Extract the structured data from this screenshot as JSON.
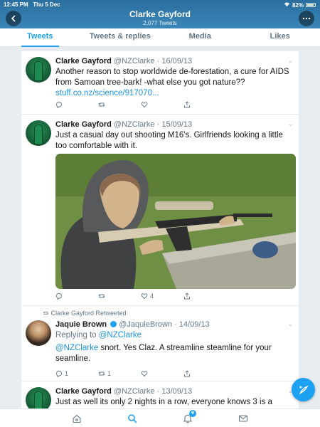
{
  "status": {
    "time": "12:45 PM",
    "day": "Thu 5 Dec",
    "battery": "82%"
  },
  "header": {
    "title": "Clarke Gayford",
    "subtitle": "2,077 Tweets"
  },
  "tabs": [
    {
      "label": "Tweets",
      "active": true
    },
    {
      "label": "Tweets & replies",
      "active": false
    },
    {
      "label": "Media",
      "active": false
    },
    {
      "label": "Likes",
      "active": false
    }
  ],
  "tweets": [
    {
      "name": "Clarke Gayford",
      "handle": "@NZClarke · 16/09/13",
      "text": "Another reason to stop worldwide de-forestation, a cure for AIDS from Samoan tree-bark! -what else you got nature??",
      "link": "stuff.co.nz/science/917070...",
      "actions": {
        "reply": "",
        "retweet": "",
        "like": "",
        "share": ""
      }
    },
    {
      "name": "Clarke Gayford",
      "handle": "@NZClarke · 15/09/13",
      "text": "Just a casual day out shooting M16's. Girlfriends looking a little too comfortable with it.",
      "actions": {
        "reply": "",
        "retweet": "",
        "like": "4",
        "share": ""
      }
    },
    {
      "retweet_label": "Clarke Gayford Retweeted",
      "name": "Jaquie Brown",
      "handle": "@JaquieBrown · 14/09/13",
      "reply_to_prefix": "Replying to",
      "reply_to": "@NZClarke",
      "mention": "@NZClarke",
      "text": " snort. Yes Claz. A streamline steamline for your seamline.",
      "actions": {
        "reply": "1",
        "retweet": "1",
        "like": "",
        "share": ""
      }
    },
    {
      "name": "Clarke Gayford",
      "handle": "@NZClarke · 13/09/13",
      "text": "Just as well its only 2 nights in a row, everyone knows 3 is a"
    }
  ],
  "bottom_nav": {
    "notifications_badge": "9"
  },
  "colors": {
    "accent": "#1da1f2",
    "header": "#2a6f9f"
  }
}
